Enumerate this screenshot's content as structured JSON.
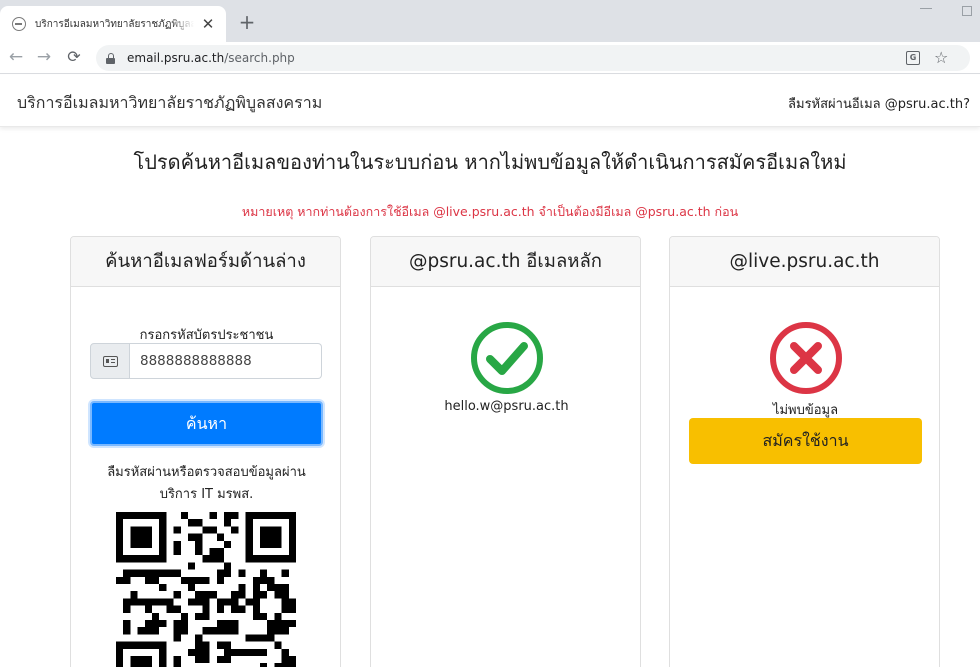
{
  "browser": {
    "tab_title": "บริการอีเมลมหาวิทยาลัยราชภัฏพิบูลสงคราม",
    "url_host": "email.psru.ac.th",
    "url_path": "/search.php",
    "icons": [
      "globe-icon",
      "close-icon",
      "plus-icon",
      "back-icon",
      "forward-icon",
      "reload-icon",
      "lock-icon",
      "translate-icon",
      "star-icon",
      "profile-icon"
    ]
  },
  "navbar": {
    "brand": "บริการอีเมลมหาวิทยาลัยราชภัฏพิบูลสงคราม",
    "forgot_link": "ลืมรหัสผ่านอีเมล @psru.ac.th?"
  },
  "headline": "โปรดค้นหาอีเมลของท่านในระบบก่อน หากไม่พบข้อมูลให้ดำเนินการสมัครอีเมลใหม่",
  "notice": "หมายเหตุ หากท่านต้องการใช้อีเมล @live.psru.ac.th จำเป็นต้องมีอีเมล @psru.ac.th ก่อน",
  "search_card": {
    "title": "ค้นหาอีเมลฟอร์มด้านล่าง",
    "field_label": "กรอกรหัสบัตรประชาชน",
    "field_value": "8888888888888",
    "button": "ค้นหา",
    "help_line1": "ลืมรหัสผ่านหรือตรวจสอบข้อมูลผ่าน",
    "help_line2": "บริการ IT มรพส."
  },
  "primary_card": {
    "title": "@psru.ac.th อีเมลหลัก",
    "status": "found",
    "status_color": "#28a745",
    "email": "hello.w@psru.ac.th"
  },
  "live_card": {
    "title": "@live.psru.ac.th",
    "status": "not-found",
    "status_color": "#dc3545",
    "message": "ไม่พบข้อมูล",
    "button": "สมัครใช้งาน",
    "button_color": "#f8bf00"
  },
  "colors": {
    "primary": "#007bff",
    "danger": "#dc3545",
    "success": "#28a745",
    "warning": "#f8bf00"
  }
}
